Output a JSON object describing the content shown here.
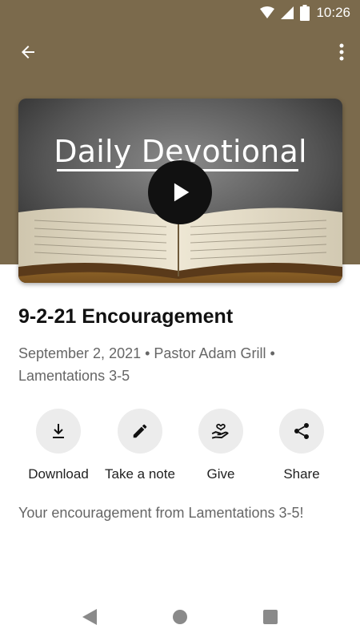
{
  "status_bar": {
    "time": "10:26",
    "icons": [
      "wifi-icon",
      "signal-icon",
      "battery-icon"
    ]
  },
  "app_bar": {
    "back_icon": "arrow-back-icon",
    "more_icon": "more-vert-icon"
  },
  "media": {
    "thumbnail_title": "Daily Devotional",
    "play_icon": "play-icon"
  },
  "sermon": {
    "title": "9-2-21 Encouragement",
    "meta": "September 2, 2021 • Pastor Adam Grill • Lamentations 3-5",
    "description": "Your encouragement from Lamentations 3-5!"
  },
  "actions": [
    {
      "label": "Download",
      "icon": "download-icon"
    },
    {
      "label": "Take a note",
      "icon": "pencil-icon"
    },
    {
      "label": "Give",
      "icon": "give-heart-hand-icon"
    },
    {
      "label": "Share",
      "icon": "share-icon"
    }
  ],
  "nav_bar": {
    "icons": [
      "nav-back-icon",
      "nav-home-icon",
      "nav-recents-icon"
    ]
  },
  "colors": {
    "header_brown": "#7b6a4c",
    "icon_circle": "#ececec",
    "meta_gray": "#666666"
  }
}
